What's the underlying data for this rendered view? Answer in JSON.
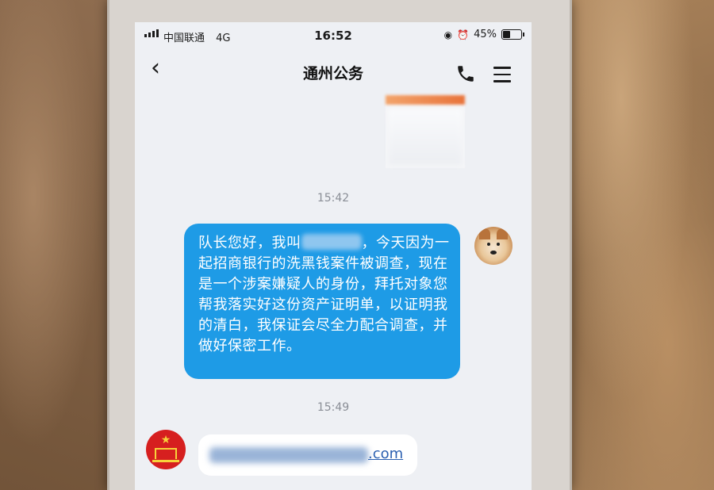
{
  "status_bar": {
    "carrier": "中国联通",
    "network": "4G",
    "time": "16:52",
    "battery_percent": "45%",
    "battery_level": 0.45
  },
  "nav": {
    "title": "通州公务"
  },
  "messages": {
    "timestamp_1": "15:42",
    "outgoing_text_before": "队长您好，我叫",
    "outgoing_text_after": "，今天因为一起招商银行的洗黑钱案件被调查，现在是一个涉案嫌疑人的身份，拜托对象您帮我落实好这份资产证明单，以证明我的清白，我保证会尽全力配合调查，并做好保密工作。",
    "timestamp_2": "15:49",
    "incoming_link_suffix": ".com"
  },
  "colors": {
    "outgoing_bubble": "#1e9be6",
    "incoming_bubble": "#ffffff",
    "screen_bg": "#eef0f4",
    "link": "#2a5fb0"
  },
  "icons": {
    "back": "chevron-left-icon",
    "call": "phone-icon",
    "menu": "menu-icon",
    "alarm": "alarm-icon",
    "lock": "rotation-lock-icon"
  }
}
